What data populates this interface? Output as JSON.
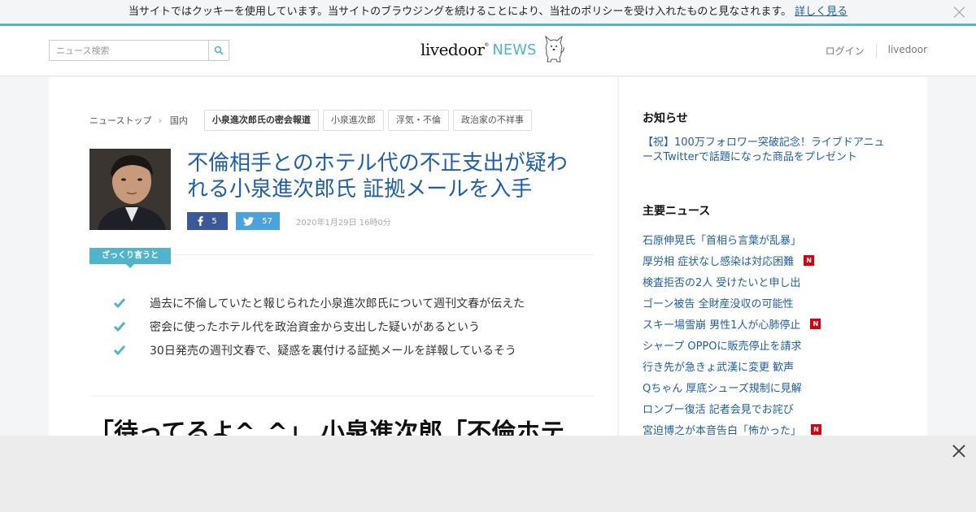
{
  "cookie": {
    "message": "当サイトではクッキーを使用しています。当サイトのブラウジングを続けることにより、当社のポリシーを受け入れたものと見なされます。",
    "link": "詳しく見る"
  },
  "header": {
    "search_placeholder": "ニュース検索",
    "logo_main": "livedoor",
    "logo_reg": "®",
    "logo_news": "NEWS",
    "login": "ログイン",
    "livedoor_link": "livedoor"
  },
  "breadcrumb": {
    "top": "ニューストップ",
    "separator": "›",
    "category": "国内",
    "tags": [
      "小泉進次郎氏の密会報道",
      "小泉進次郎",
      "浮気・不倫",
      "政治家の不祥事"
    ]
  },
  "article": {
    "title": "不倫相手とのホテル代の不正支出が疑われる小泉進次郎氏 証拠メールを入手",
    "fb_count": "5",
    "tw_count": "57",
    "date": "2020年1月29日 16時0分",
    "summary_label": "ざっくり言うと",
    "summary": [
      "過去に不倫していたと報じられた小泉進次郎氏について週刊文春が伝えた",
      "密会に使ったホテル代を政治資金から支出した疑いがあるという",
      "30日発売の週刊文春で、疑惑を裏付ける証拠メールを詳報しているそう"
    ],
    "subhead": "「待ってるよ^_^」 小泉進次郎「不倫ホテ"
  },
  "sidebar": {
    "notice_title": "お知らせ",
    "notice_link": "【祝】100万フォロワー突破記念！ライブドアニュースTwitterで話題になった商品をプレゼント",
    "news_title": "主要ニュース",
    "badge_label": "N",
    "news": [
      {
        "text": "石原伸晃氏「首相ら言葉が乱暴」",
        "new": false
      },
      {
        "text": "厚労相 症状なし感染は対応困難",
        "new": true
      },
      {
        "text": "検査拒否の2人 受けたいと申し出",
        "new": false
      },
      {
        "text": "ゴーン被告 全財産没収の可能性",
        "new": false
      },
      {
        "text": "スキー場雪崩 男性1人が心肺停止",
        "new": true
      },
      {
        "text": "シャープ OPPOに販売停止を請求",
        "new": false
      },
      {
        "text": "行き先が急きょ武漢に変更 歓声",
        "new": false
      },
      {
        "text": "Qちゃん 厚底シューズ規制に見解",
        "new": false
      },
      {
        "text": "ロンブー復活 記者会見でお詫び",
        "new": false
      },
      {
        "text": "宮迫博之が本音告白「怖かった」",
        "new": true
      }
    ]
  },
  "colors": {
    "accent": "#4fb4cc",
    "link": "#1f5ea8",
    "facebook": "#3b5998",
    "twitter": "#4aa3dc",
    "badge": "#d7000f"
  }
}
